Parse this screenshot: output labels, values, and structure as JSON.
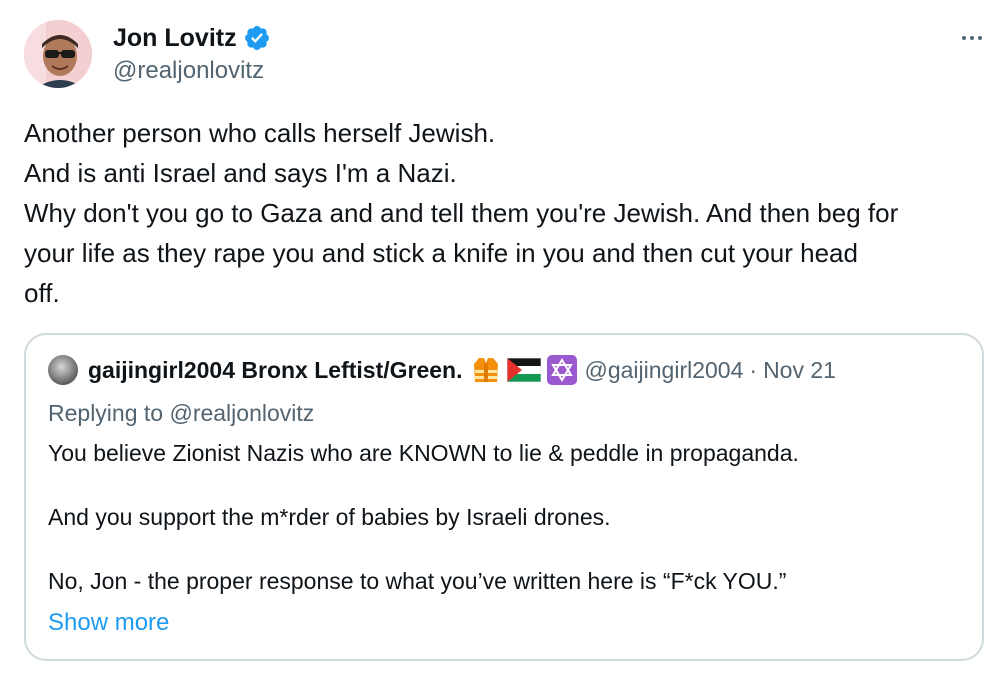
{
  "author": {
    "name": "Jon Lovitz",
    "handle": "@realjonlovitz",
    "verified_color": "#1d9bf0"
  },
  "tweet": {
    "lines": [
      "Another person who calls herself Jewish.",
      "And is anti Israel and says I'm a Nazi.",
      "Why don't you go to Gaza and and tell them you're Jewish. And then beg for",
      "your life as they rape you and stick a knife in you and then cut your head",
      "off."
    ]
  },
  "quote": {
    "name": "gaijingirl2004 Bronx Leftist/Green.",
    "flags": [
      "safety-vest-emoji",
      "palestine-flag-emoji",
      "star-of-david-emoji"
    ],
    "handle": "@gaijingirl2004",
    "separator": "·",
    "date": "Nov 21",
    "replying_prefix": "Replying to",
    "replying_to": "@realjonlovitz",
    "paragraphs": [
      "You believe Zionist Nazis who are KNOWN to lie & peddle in propaganda.",
      "And you support the m*rder of babies by Israeli drones.",
      "No, Jon - the proper response to what you’ve written here is “F*ck YOU.”"
    ],
    "show_more": "Show more"
  },
  "colors": {
    "text": "#0f1419",
    "secondary": "#536471",
    "link": "#1d9bf0",
    "border": "#cfd9de"
  }
}
